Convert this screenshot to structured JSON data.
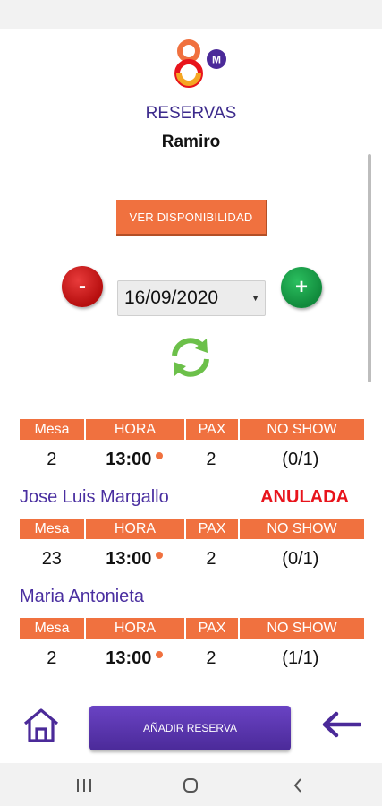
{
  "header": {
    "title": "RESERVAS",
    "user": "Ramiro"
  },
  "controls": {
    "ver_disponibilidad_label": "VER DISPONIBILIDAD",
    "minus_label": "-",
    "plus_label": "+",
    "date_value": "16/09/2020"
  },
  "table_headers": {
    "mesa": "Mesa",
    "hora": "HORA",
    "pax": "PAX",
    "no_show": "NO SHOW"
  },
  "reservations": [
    {
      "mesa": "2",
      "hora": "13:00",
      "pax": "2",
      "no_show": "(0/1)",
      "name": "Jose Luis Margallo",
      "status": "ANULADA"
    },
    {
      "mesa": "23",
      "hora": "13:00",
      "pax": "2",
      "no_show": "(0/1)",
      "name": "Maria Antonieta",
      "status": ""
    },
    {
      "mesa": "2",
      "hora": "13:00",
      "pax": "2",
      "no_show": "(1/1)"
    }
  ],
  "footer": {
    "add_label": "AÑADIR RESERVA"
  },
  "icons": {
    "home": "home-icon",
    "back": "back-arrow-icon",
    "refresh": "refresh-icon",
    "logo": "app-logo"
  },
  "colors": {
    "accent": "#f0713f",
    "brand_purple": "#4b2a99",
    "danger": "#e8141c"
  }
}
